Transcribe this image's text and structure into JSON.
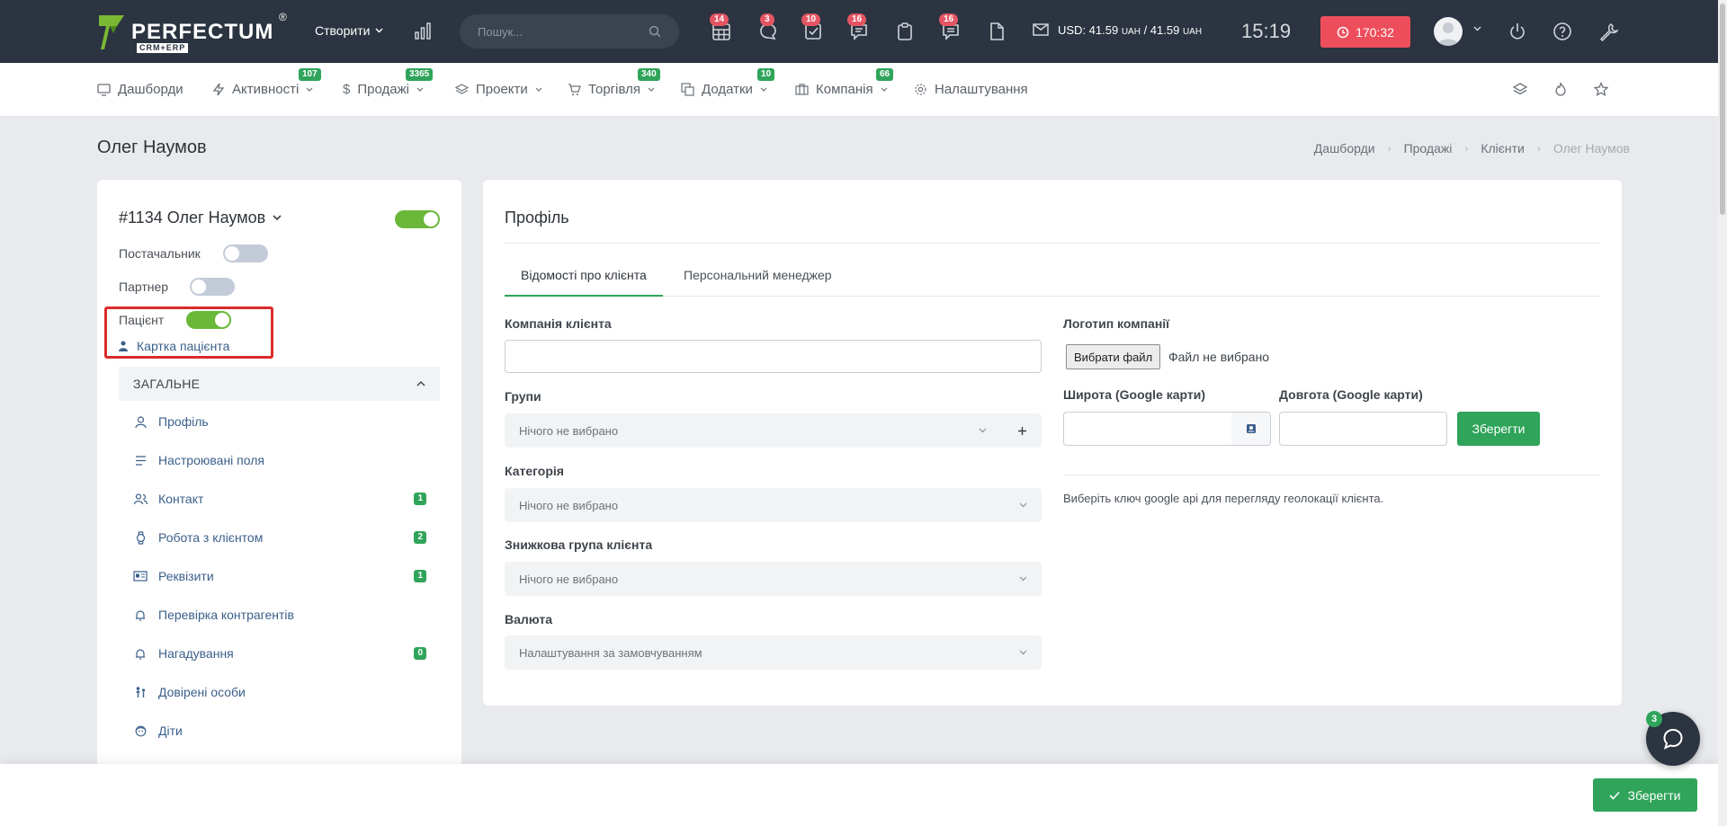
{
  "topbar": {
    "logo": "PERFECTUM",
    "logo_sub": "CRM+ERP",
    "logo_reg": "®",
    "create_label": "Створити",
    "search_placeholder": "Пошук...",
    "icons": [
      {
        "name": "calendar-grid-icon",
        "badge": "14"
      },
      {
        "name": "chat-bubble-icon",
        "badge": "3"
      },
      {
        "name": "task-check-icon",
        "badge": "10"
      },
      {
        "name": "messages-icon",
        "badge": "16"
      },
      {
        "name": "clipboard-icon",
        "badge": ""
      },
      {
        "name": "comments-icon",
        "badge": "16"
      },
      {
        "name": "document-icon",
        "badge": ""
      }
    ],
    "currency_prefix": "USD: 41.59",
    "currency_unit1": "UAH",
    "currency_sep": " / 41.59",
    "currency_unit2": "UAH",
    "time": "15:19",
    "timer": "170:32"
  },
  "nav": {
    "items": [
      {
        "label": "Дашборди",
        "badge": "",
        "icon": "monitor-icon"
      },
      {
        "label": "Активності",
        "badge": "107",
        "icon": "bolt-icon"
      },
      {
        "label": "Продажі",
        "badge": "3365",
        "icon": "dollar-icon"
      },
      {
        "label": "Проекти",
        "badge": "",
        "icon": "layers-icon"
      },
      {
        "label": "Торгівля",
        "badge": "340",
        "icon": "cart-icon"
      },
      {
        "label": "Додатки",
        "badge": "10",
        "icon": "copy-icon"
      },
      {
        "label": "Компанія",
        "badge": "66",
        "icon": "briefcase-icon"
      },
      {
        "label": "Налаштування",
        "badge": "",
        "icon": "gear-icon"
      }
    ]
  },
  "page": {
    "title": "Олег Наумов",
    "breadcrumb": [
      "Дашборди",
      "Продажі",
      "Клієнти",
      "Олег Наумов"
    ]
  },
  "client": {
    "title": "#1134 Олег Наумов",
    "active": true,
    "supplier_label": "Постачальник",
    "supplier_on": false,
    "partner_label": "Партнер",
    "partner_on": false,
    "patient_label": "Пацієнт",
    "patient_on": true,
    "patient_card_link": "Картка пацієнта",
    "section_header": "ЗАГАЛЬНЕ",
    "menu": [
      {
        "label": "Профіль",
        "badge": "",
        "icon": "user-icon"
      },
      {
        "label": "Настроювані поля",
        "badge": "",
        "icon": "lines-icon"
      },
      {
        "label": "Контакт",
        "badge": "1",
        "icon": "users-icon"
      },
      {
        "label": "Робота з клієнтом",
        "badge": "2",
        "icon": "watch-icon"
      },
      {
        "label": "Реквізити",
        "badge": "1",
        "icon": "id-card-icon"
      },
      {
        "label": "Перевірка контрагентів",
        "badge": "",
        "icon": "bell-icon"
      },
      {
        "label": "Нагадування",
        "badge": "0",
        "icon": "bell-icon"
      },
      {
        "label": "Довірені особи",
        "badge": "",
        "icon": "people-icon"
      },
      {
        "label": "Діти",
        "badge": "",
        "icon": "baby-icon"
      }
    ]
  },
  "profile": {
    "title": "Профіль",
    "tabs": [
      "Відомості про клієнта",
      "Персональний менеджер"
    ],
    "company_label": "Компанія клієнта",
    "company_value": "",
    "groups_label": "Групи",
    "groups_value": "Нічого не вибрано",
    "category_label": "Категорія",
    "category_value": "Нічого не вибрано",
    "discount_label": "Знижкова група клієнта",
    "discount_value": "Нічого не вибрано",
    "currency_label": "Валюта",
    "currency_value": "Налаштування за замовчуванням",
    "logo_label": "Логотип компанії",
    "file_button": "Вибрати файл",
    "file_status": "Файл не вибрано",
    "lat_label": "Широта (Google карти)",
    "lng_label": "Довгота (Google карти)",
    "save_label": "Зберегти",
    "geo_note": "Виберіть ключ google api для перегляду геолокації клієнта."
  },
  "footer": {
    "save_label": "Зберегти",
    "chat_badge": "3"
  },
  "colors": {
    "topbar": "#2b3440",
    "accent_green": "#2fa45a",
    "badge_red": "#e45563",
    "timer_red": "#ee4e5c",
    "highlight": "#dc2b2b"
  }
}
